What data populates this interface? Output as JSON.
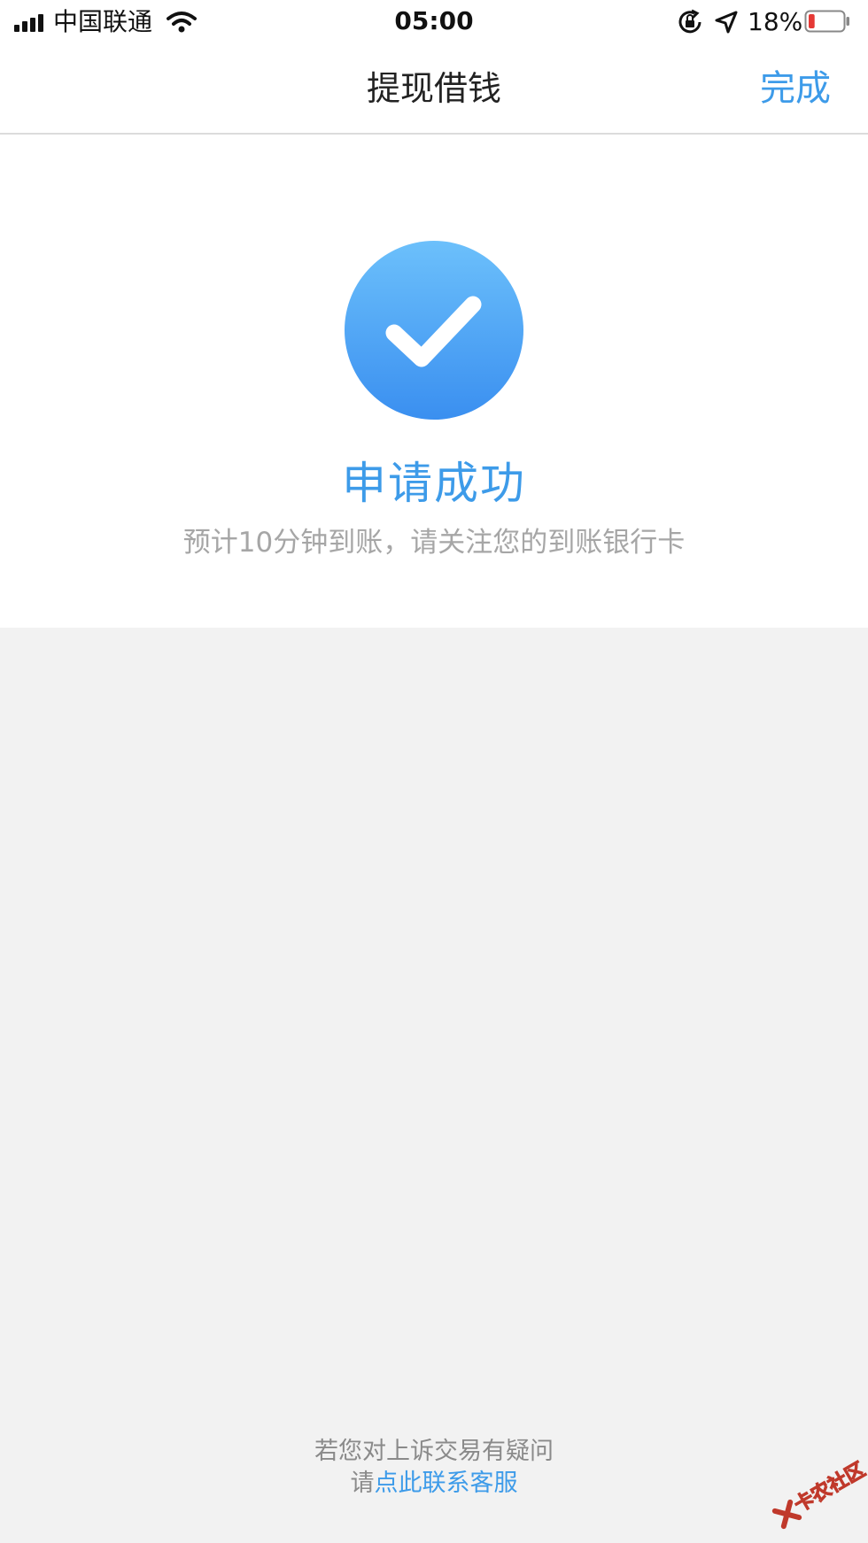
{
  "status_bar": {
    "carrier": "中国联通",
    "time": "05:00",
    "battery_percent": "18%",
    "battery_level": 0.18,
    "battery_color": "#e53935",
    "icons": [
      "signal-icon",
      "wifi-icon",
      "rotation-lock-icon",
      "location-arrow-icon",
      "battery-icon"
    ]
  },
  "nav": {
    "title": "提现借钱",
    "done_label": "完成"
  },
  "result": {
    "icon": "check-circle-icon",
    "title": "申请成功",
    "subtitle": "预计10分钟到账，请关注您的到账银行卡"
  },
  "footer": {
    "question": "若您对上诉交易有疑问",
    "prefix": "请",
    "contact_link": "点此联系客服"
  },
  "watermark": {
    "text": "卡农社区"
  },
  "colors": {
    "accent": "#3d9be9",
    "background": "#f2f2f2",
    "card": "#ffffff",
    "muted_text": "#a6a6a6"
  }
}
